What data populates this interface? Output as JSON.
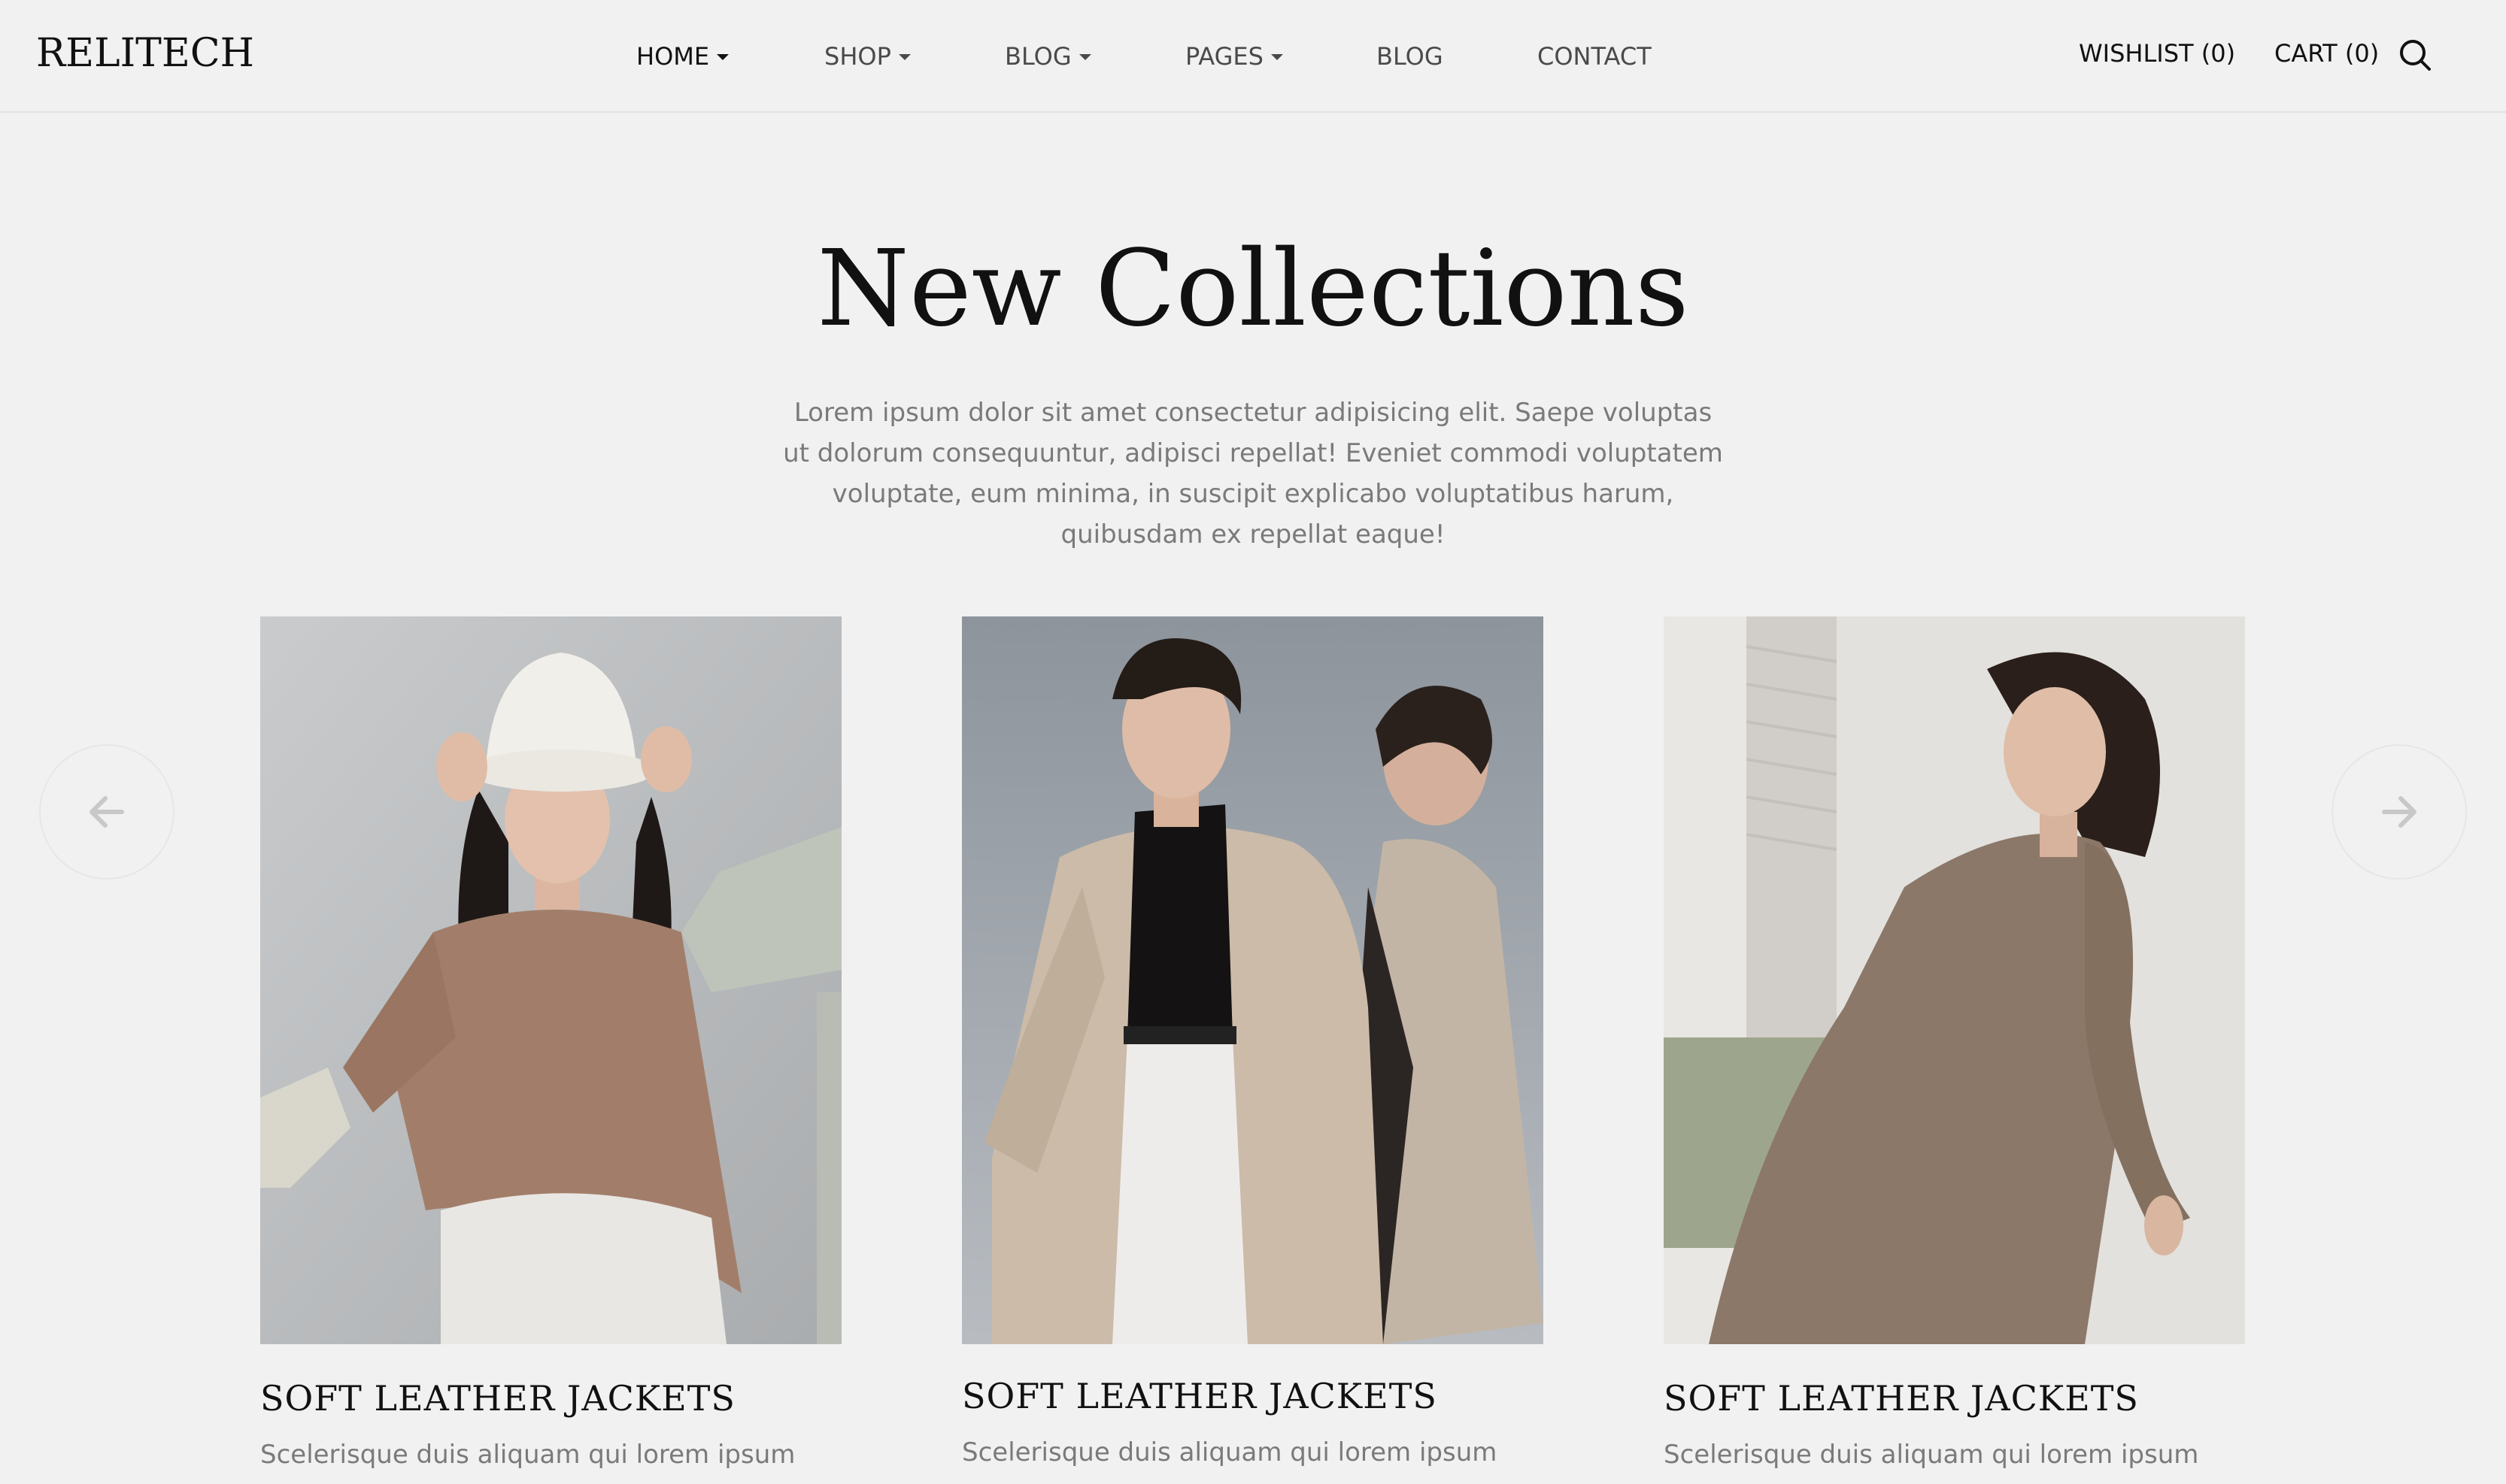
{
  "header": {
    "logo": "RELITECH",
    "nav": [
      {
        "label": "HOME",
        "has_dropdown": true,
        "active": true
      },
      {
        "label": "SHOP",
        "has_dropdown": true,
        "active": false
      },
      {
        "label": "BLOG",
        "has_dropdown": true,
        "active": false
      },
      {
        "label": "PAGES",
        "has_dropdown": true,
        "active": false
      },
      {
        "label": "BLOG",
        "has_dropdown": false,
        "active": false
      },
      {
        "label": "CONTACT",
        "has_dropdown": false,
        "active": false
      }
    ],
    "wishlist_label": "WISHLIST (0)",
    "cart_label": "CART (0)",
    "search_icon": "search-icon"
  },
  "hero": {
    "title": "New Collections",
    "description": "Lorem ipsum dolor sit amet consectetur adipisicing elit. Saepe voluptas ut dolorum consequuntur, adipisci repellat! Eveniet commodi voluptatem voluptate, eum minima, in suscipit explicabo voluptatibus harum, quibusdam ex repellat eaque!"
  },
  "carousel": {
    "prev_icon": "arrow-left-icon",
    "next_icon": "arrow-right-icon",
    "cards": [
      {
        "title": "SOFT LEATHER JACKETS",
        "text": "Scelerisque duis aliquam qui lorem ipsum"
      },
      {
        "title": "SOFT LEATHER JACKETS",
        "text": "Scelerisque duis aliquam qui lorem ipsum"
      },
      {
        "title": "SOFT LEATHER JACKETS",
        "text": "Scelerisque duis aliquam qui lorem ipsum"
      }
    ]
  },
  "colors": {
    "background": "#f1f1f1",
    "text_primary": "#111111",
    "text_muted": "#7a7a7a"
  }
}
